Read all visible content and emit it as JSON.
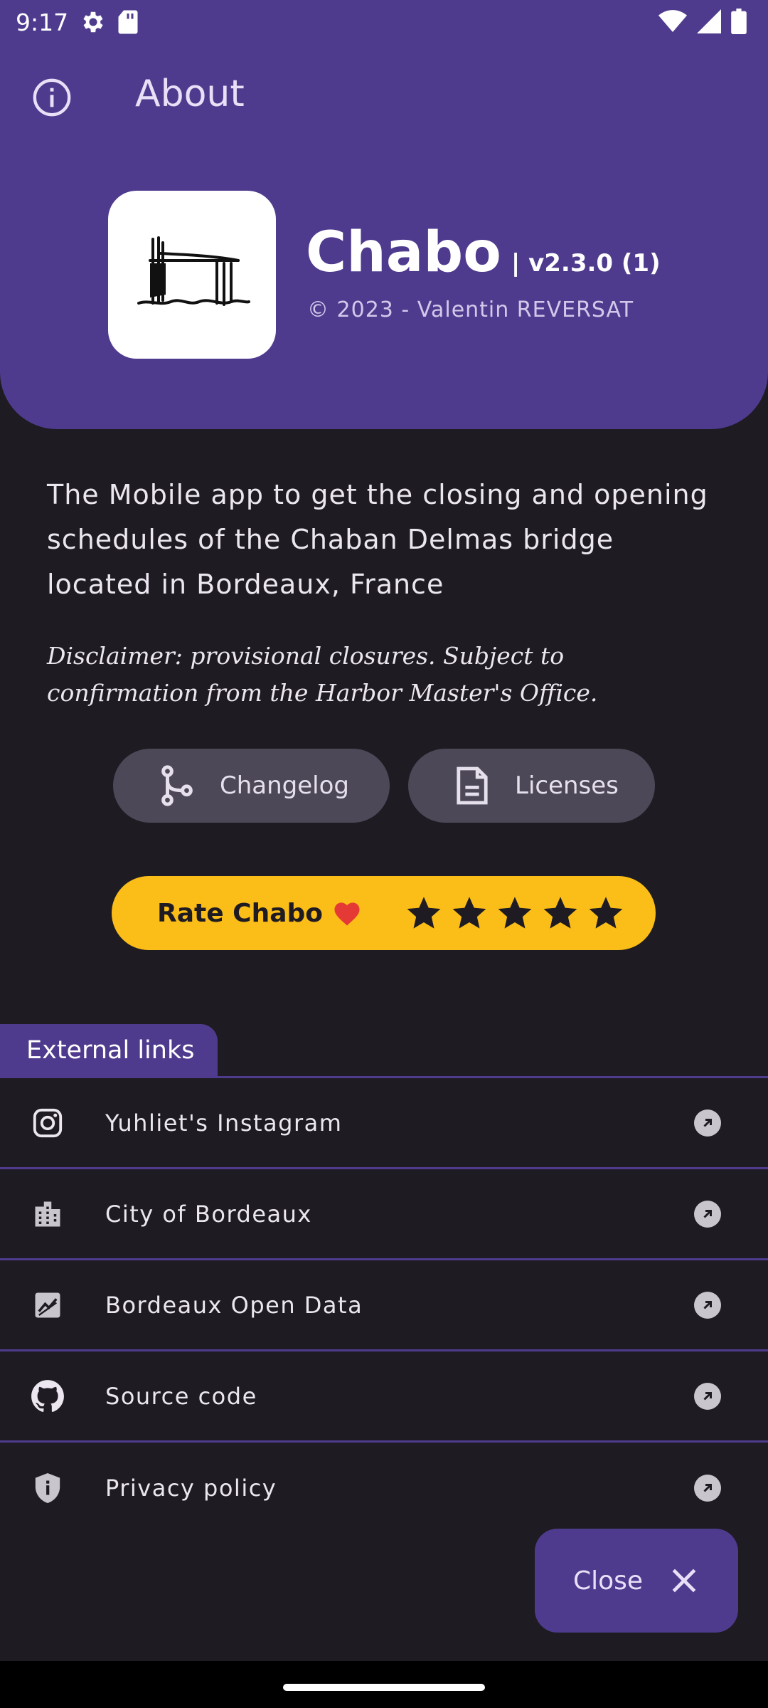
{
  "status_bar": {
    "time": "9:17"
  },
  "app_bar": {
    "title": "About",
    "icon": "info-icon"
  },
  "app_info": {
    "name": "Chabo",
    "version": "| v2.3.0 (1)",
    "copyright": "© 2023 - Valentin REVERSAT",
    "logo": "bridge-logo"
  },
  "description": "The Mobile app to get the closing and opening schedules of the Chaban Delmas bridge located in Bordeaux, France",
  "disclaimer": "Disclaimer: provisional closures. Subject to confirmation from the Harbor Master's Office.",
  "buttons": {
    "changelog": "Changelog",
    "licenses": "Licenses",
    "rate": "Rate Chabo",
    "rating_stars": 5
  },
  "external_links": {
    "title": "External links",
    "items": [
      {
        "label": "Yuhliet's Instagram",
        "icon": "instagram-icon"
      },
      {
        "label": "City of Bordeaux",
        "icon": "city-icon"
      },
      {
        "label": "Bordeaux Open Data",
        "icon": "chart-icon"
      },
      {
        "label": "Source code",
        "icon": "github-icon"
      },
      {
        "label": "Privacy policy",
        "icon": "shield-icon"
      }
    ]
  },
  "fab": {
    "label": "Close"
  },
  "colors": {
    "primary": "#4f3b8e",
    "background": "#1e1c22",
    "rate_button": "#fbbd18",
    "tonal_button": "#4d4858"
  }
}
